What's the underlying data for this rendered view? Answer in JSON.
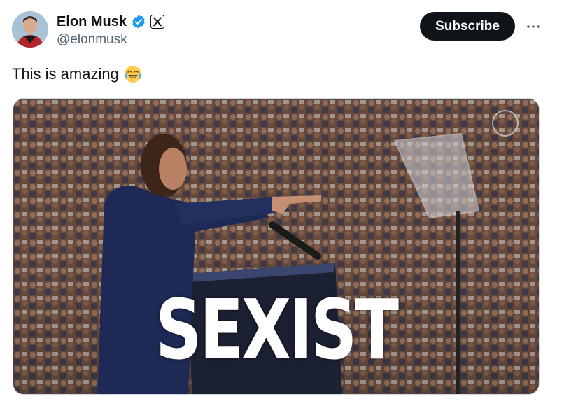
{
  "author": {
    "display_name": "Elon Musk",
    "handle": "@elonmusk",
    "verified": true
  },
  "actions": {
    "subscribe_label": "Subscribe",
    "more_icon": "more-horizontal-icon"
  },
  "tweet": {
    "text": "This is amazing",
    "emoji": "face-with-tears-of-joy"
  },
  "media": {
    "overlay_text": "SEXIST"
  },
  "colors": {
    "verified_blue": "#1d9bf0",
    "button_bg": "#0f1419",
    "handle_gray": "#536471"
  }
}
